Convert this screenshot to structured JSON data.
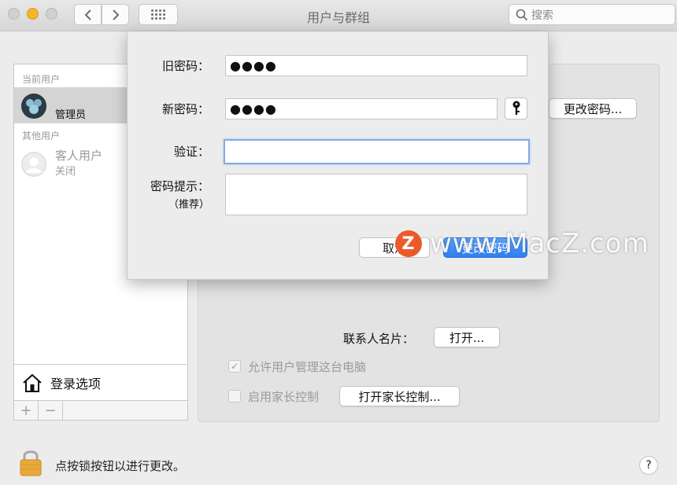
{
  "window": {
    "title": "用户与群组",
    "search_placeholder": "搜索"
  },
  "sidebar": {
    "current_user_label": "当前用户",
    "current_user": {
      "name": "",
      "role": "管理员"
    },
    "other_users_label": "其他用户",
    "guest_user": {
      "name": "客人用户",
      "status": "关闭"
    },
    "login_options": "登录选项",
    "add_label": "+",
    "remove_label": "−"
  },
  "main": {
    "change_password_button": "更改密码...",
    "contact_card_label": "联系人名片：",
    "open_button": "打开...",
    "allow_admin_label": "允许用户管理这台电脑",
    "allow_admin_checked": true,
    "parental_label": "启用家长控制",
    "parental_checked": false,
    "open_parental_button": "打开家长控制..."
  },
  "dialog": {
    "old_password_label": "旧密码：",
    "old_password_value": "●●●●",
    "new_password_label": "新密码：",
    "new_password_value": "●●●●",
    "verify_label": "验证：",
    "verify_value": "",
    "hint_label": "密码提示：",
    "hint_sub_label": "（推荐）",
    "hint_value": "",
    "cancel_button": "取消",
    "confirm_button": "更改密码"
  },
  "footer": {
    "lock_text": "点按锁按钮以进行更改。",
    "help_label": "?"
  },
  "watermark": {
    "logo_letter": "Z",
    "text": "www.MacZ.com"
  },
  "colors": {
    "accent_blue": "#2f7ff0",
    "focus_ring": "#86a9e8",
    "lock_gold": "#e9a93a",
    "watermark_logo": "#ea5a2a"
  }
}
